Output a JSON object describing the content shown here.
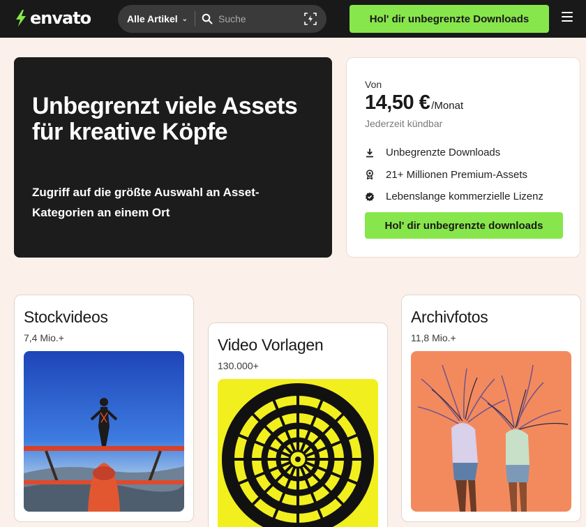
{
  "header": {
    "logo_text": "envato",
    "category_select": "Alle Artikel",
    "search_placeholder": "Suche",
    "cta": "Hol' dir unbegrenzte Downloads"
  },
  "hero": {
    "title": "Unbegrenzt viele Assets für kreative Köpfe",
    "subtitle": "Zugriff auf die größte Auswahl an Asset-Kategorien an einem Ort"
  },
  "pricing": {
    "from": "Von",
    "amount": "14,50 €",
    "period": "/Monat",
    "cancel_note": "Jederzeit kündbar",
    "features": [
      {
        "icon": "download-icon",
        "label": "Unbegrenzte Downloads"
      },
      {
        "icon": "award-icon",
        "label": "21+ Millionen Premium-Assets"
      },
      {
        "icon": "verified-badge-icon",
        "label": "Lebenslange kommerzielle Lizenz"
      }
    ],
    "cta": "Hol' dir unbegrenzte downloads"
  },
  "categories": [
    {
      "title": "Stockvideos",
      "count": "7,4 Mio.+"
    },
    {
      "title": "Video Vorlagen",
      "count": "130.000+"
    },
    {
      "title": "Archivfotos",
      "count": "11,8 Mio.+"
    }
  ],
  "colors": {
    "accent": "#87e64b",
    "page_bg": "#fbf1ea",
    "dark": "#191919"
  }
}
